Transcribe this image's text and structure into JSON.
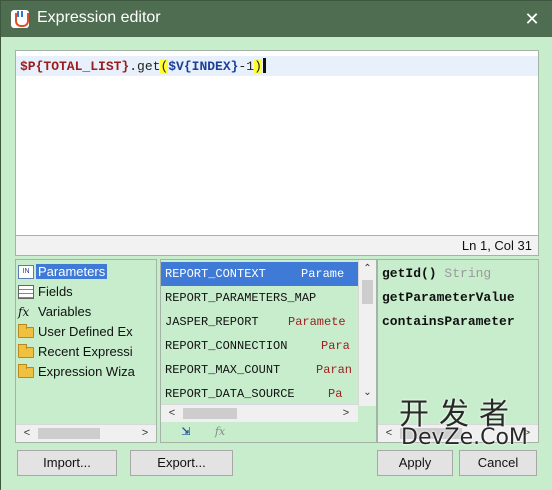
{
  "window": {
    "title": "Expression editor",
    "close_glyph": "✕"
  },
  "editor": {
    "tokens": [
      {
        "kind": "param",
        "text": "$P{TOTAL_LIST}"
      },
      {
        "kind": "plain",
        "text": ".get"
      },
      {
        "kind": "paren",
        "text": "("
      },
      {
        "kind": "var",
        "text": "$V{INDEX}"
      },
      {
        "kind": "plain",
        "text": "-1"
      },
      {
        "kind": "paren",
        "text": ")"
      }
    ],
    "status": "Ln 1, Col 31"
  },
  "categories": [
    {
      "label": "Parameters",
      "icon": "parameters-icon",
      "selected": true
    },
    {
      "label": "Fields",
      "icon": "fields-icon",
      "selected": false
    },
    {
      "label": "Variables",
      "icon": "fx-icon",
      "selected": false
    },
    {
      "label": "User Defined Ex",
      "icon": "folder-icon",
      "selected": false
    },
    {
      "label": "Recent Expressi",
      "icon": "folder-icon",
      "selected": false
    },
    {
      "label": "Expression Wiza",
      "icon": "folder-icon",
      "selected": false
    }
  ],
  "parameters": [
    {
      "name": "REPORT_CONTEXT",
      "type": "Parame",
      "selected": true
    },
    {
      "name": "REPORT_PARAMETERS_MAP",
      "type": "",
      "selected": false
    },
    {
      "name": "JASPER_REPORT",
      "type": "Paramete",
      "selected": false
    },
    {
      "name": "REPORT_CONNECTION",
      "type": "Para",
      "selected": false
    },
    {
      "name": "REPORT_MAX_COUNT",
      "type": "Paran",
      "selected": false
    },
    {
      "name": "REPORT_DATA_SOURCE",
      "type": "Pa",
      "selected": false
    }
  ],
  "methods": [
    {
      "name": "getId()",
      "type": "String"
    },
    {
      "name": "getParameterValue",
      "type": ""
    },
    {
      "name": "containsParameter",
      "type": ""
    }
  ],
  "buttons": {
    "import": "Import...",
    "export": "Export...",
    "apply": "Apply",
    "cancel": "Cancel"
  },
  "watermark": {
    "cn": "开发者",
    "en": "DevZe.CoM"
  }
}
